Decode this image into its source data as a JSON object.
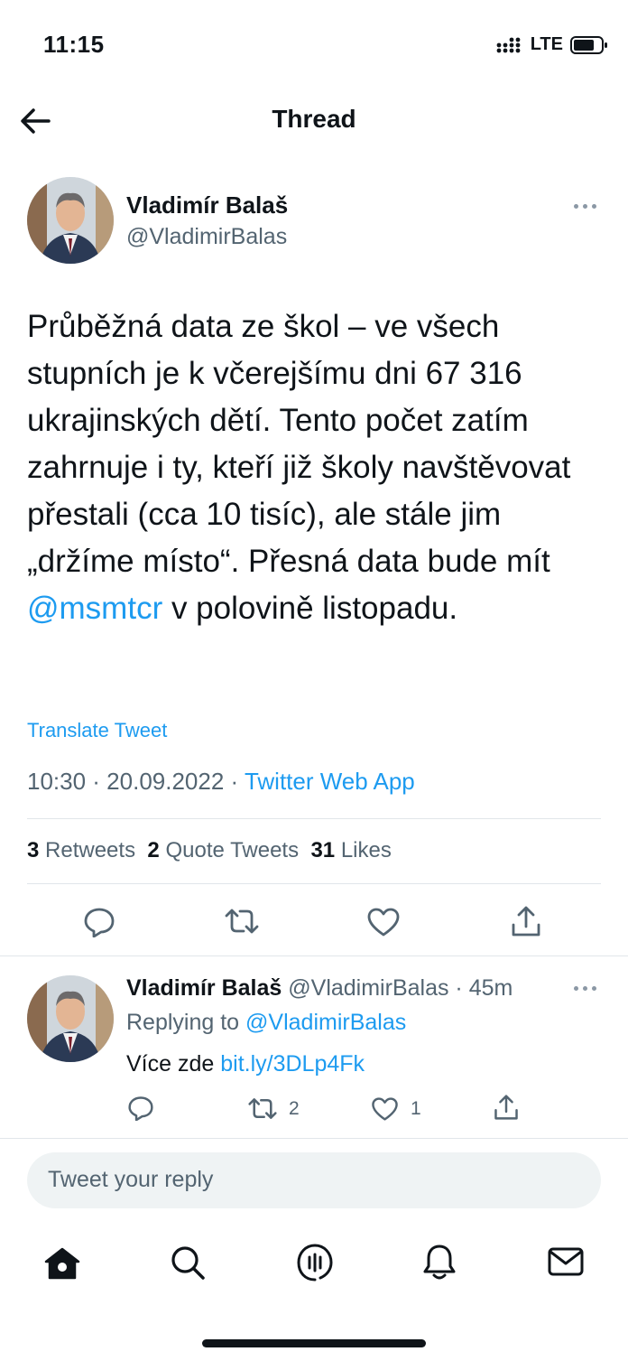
{
  "status_bar": {
    "time": "11:15",
    "network": "LTE"
  },
  "header": {
    "title": "Thread"
  },
  "tweet": {
    "author_name": "Vladimír Balaš",
    "author_handle": "@VladimirBalas",
    "text_before_mention": "Průběžná data ze škol – ve všech stupních je k včerejšímu dni 67 316 ukrajinských dětí. Tento počet zatím zahrnuje i ty, kteří již školy navštěvovat přestali (cca 10 tisíc), ale stále jim „držíme místo“. Přesná data bude mít ",
    "mention": "@msmtcr",
    "text_after_mention": " v polovině listopadu.",
    "translate_label": "Translate Tweet",
    "timestamp": "10:30 · 20.09.2022 · ",
    "source": "Twitter Web App",
    "retweets_count": "3",
    "retweets_label": "Retweets",
    "quotes_count": "2",
    "quotes_label": "Quote Tweets",
    "likes_count": "31",
    "likes_label": "Likes"
  },
  "reply": {
    "author_name": "Vladimír Balaš",
    "author_handle_time": "@VladimirBalas · 45m",
    "replying_prefix": "Replying to ",
    "replying_to": "@VladimirBalas",
    "text": "Více zde ",
    "link": "bit.ly/3DLp4Fk",
    "retweet_count": "2",
    "like_count": "1"
  },
  "compose": {
    "placeholder": "Tweet your reply"
  },
  "colors": {
    "accent": "#1d9bf0",
    "text": "#0f1419",
    "muted": "#536471"
  },
  "bottom_nav": [
    "home-icon",
    "search-icon",
    "spaces-icon",
    "notifications-icon",
    "messages-icon"
  ]
}
